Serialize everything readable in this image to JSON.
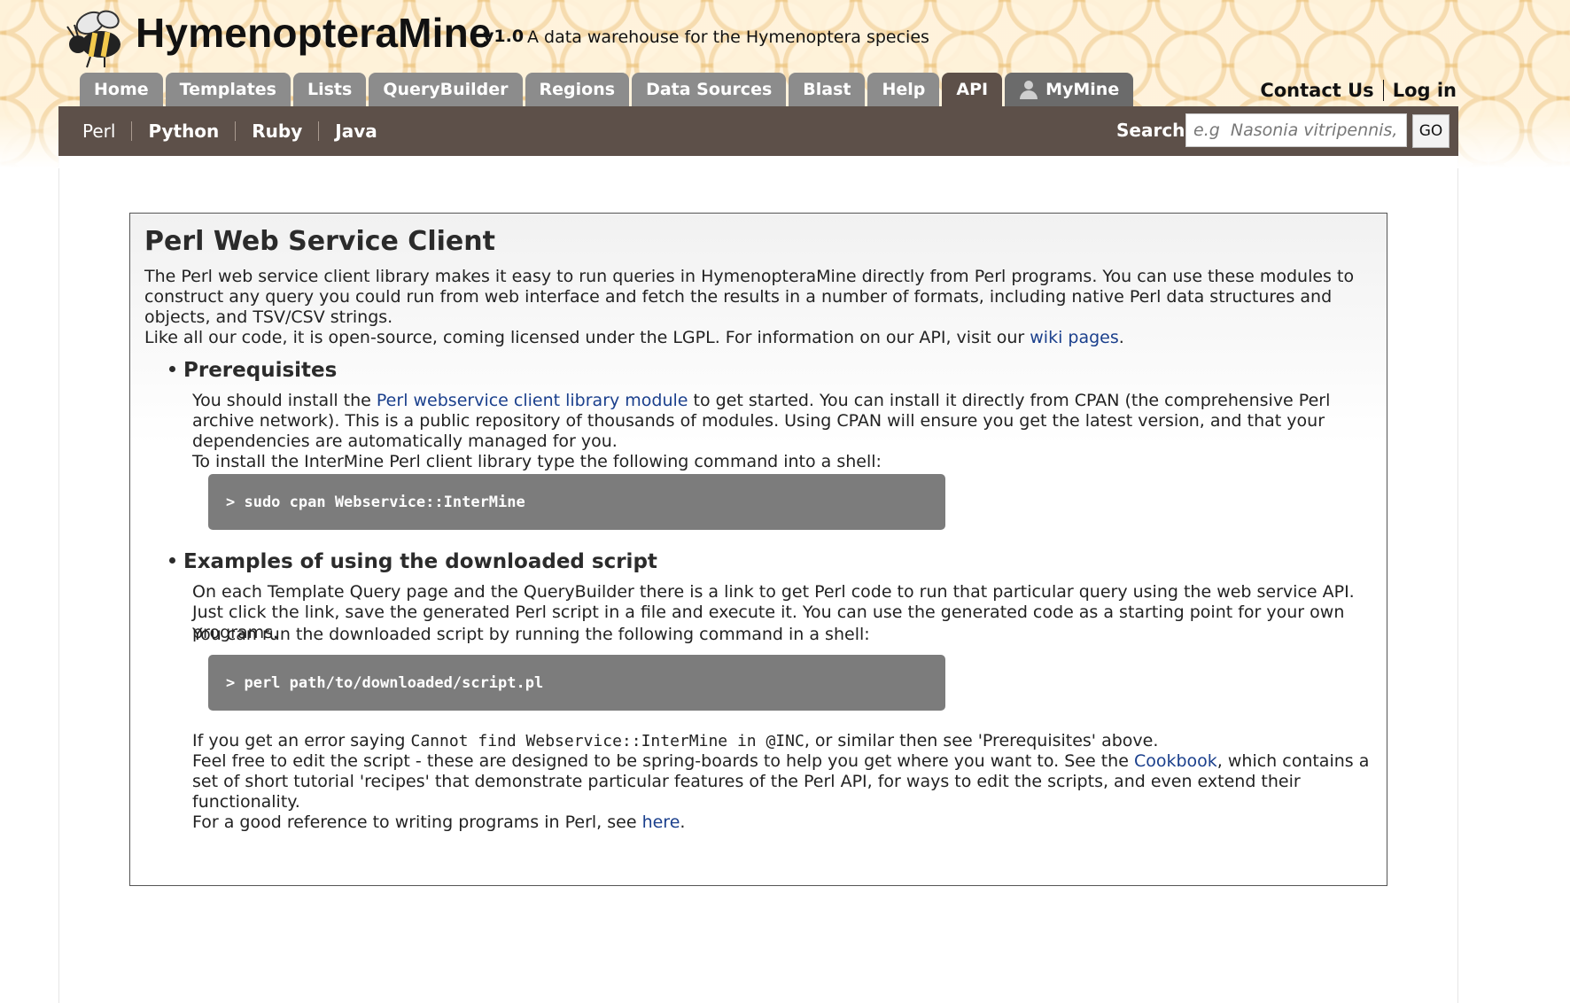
{
  "header": {
    "brand": "HymenopteraMine",
    "version": "v1.0",
    "tagline": "A data warehouse for the Hymenoptera species",
    "tabs": [
      {
        "label": "Home"
      },
      {
        "label": "Templates"
      },
      {
        "label": "Lists"
      },
      {
        "label": "QueryBuilder"
      },
      {
        "label": "Regions"
      },
      {
        "label": "Data Sources"
      },
      {
        "label": "Blast"
      },
      {
        "label": "Help"
      },
      {
        "label": "API"
      },
      {
        "label": "MyMine"
      }
    ],
    "contact_label": "Contact Us",
    "login_label": "Log in"
  },
  "subnav": {
    "items": [
      "Perl",
      "Python",
      "Ruby",
      "Java"
    ],
    "search_label": "Search:",
    "search_placeholder": "e.g  Nasonia vitripennis, A",
    "go_label": "GO"
  },
  "main": {
    "title": "Perl Web Service Client",
    "intro_1": "The Perl web service client library makes it easy to run queries in HymenopteraMine directly from Perl programs. You can use these modules to construct any query you could run from web interface and fetch the results in a number of formats, including native Perl data structures and objects, and TSV/CSV strings.",
    "intro_2_pre": "Like all our code, it is open-source, coming licensed under the LGPL. For information on our API, visit our ",
    "intro_2_link": "wiki pages",
    "intro_2_post": ".",
    "prereq_heading": "Prerequisites",
    "prereq_pre": "You should install the ",
    "prereq_link": "Perl webservice client library module",
    "prereq_post": " to get started. You can install it directly from CPAN (the comprehensive Perl archive network). This is a public repository of thousands of modules. Using CPAN will ensure you get the latest version, and that your dependencies are automatically managed for you.",
    "prereq_install": "To install the InterMine Perl client library type the following command into a shell:",
    "install_cmd": "> sudo cpan Webservice::InterMine",
    "examples_heading": "Examples of using the downloaded script",
    "examples_p1": "On each Template Query page and the QueryBuilder there is a link to get Perl code to run that particular query using the web service API. Just click the link, save the generated Perl script in a file and execute it. You can use the generated code as a starting point for your own programs.",
    "examples_p2": "You can run the downloaded script by running the following command in a shell:",
    "run_cmd": "> perl path/to/downloaded/script.pl",
    "error_pre": "If you get an error saying ",
    "error_code": "Cannot find Webservice::InterMine in @INC",
    "error_post": ", or similar then see 'Prerequisites' above.",
    "edit_pre": "Feel free to edit the script - these are designed to be spring-boards to help you get where you want to. See the ",
    "edit_link": "Cookbook",
    "edit_post": ", which contains a set of short tutorial 'recipes' that demonstrate particular features of the Perl API, for ways to edit the scripts, and even extend their functionality.",
    "ref_pre": "For a good reference to writing programs in Perl, see ",
    "ref_link": "here",
    "ref_post": "."
  },
  "colors": {
    "header_bar": "#5d5049",
    "tab_inactive": "#8c8c8c",
    "code_bg": "#7c7c7c",
    "link": "#1a3f8c"
  }
}
